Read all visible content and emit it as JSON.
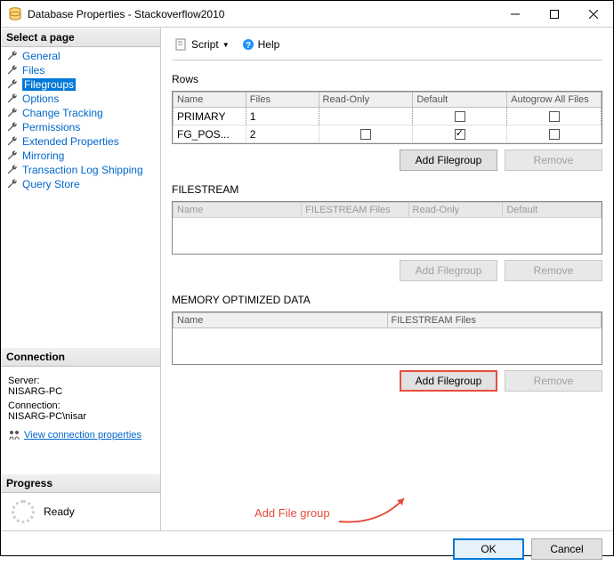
{
  "window": {
    "title": "Database Properties - Stackoverflow2010"
  },
  "sidebar": {
    "select_page": "Select a page",
    "items": [
      {
        "label": "General"
      },
      {
        "label": "Files"
      },
      {
        "label": "Filegroups"
      },
      {
        "label": "Options"
      },
      {
        "label": "Change Tracking"
      },
      {
        "label": "Permissions"
      },
      {
        "label": "Extended Properties"
      },
      {
        "label": "Mirroring"
      },
      {
        "label": "Transaction Log Shipping"
      },
      {
        "label": "Query Store"
      }
    ],
    "connection_header": "Connection",
    "server_label": "Server:",
    "server_value": "NISARG-PC",
    "connection_label": "Connection:",
    "connection_value": "NISARG-PC\\nisar",
    "view_conn_props": "View connection properties",
    "progress_header": "Progress",
    "progress_status": "Ready"
  },
  "toolbar": {
    "script": "Script",
    "help": "Help"
  },
  "rows": {
    "title": "Rows",
    "headers": [
      "Name",
      "Files",
      "Read-Only",
      "Default",
      "Autogrow All Files"
    ],
    "data": [
      {
        "name": "PRIMARY",
        "files": "1",
        "readonly": null,
        "default": false,
        "autogrow": false
      },
      {
        "name": "FG_POS...",
        "files": "2",
        "readonly": false,
        "default": true,
        "autogrow": false
      }
    ],
    "add": "Add Filegroup",
    "remove": "Remove"
  },
  "filestream": {
    "title": "FILESTREAM",
    "headers": [
      "Name",
      "FILESTREAM Files",
      "Read-Only",
      "Default"
    ],
    "add": "Add Filegroup",
    "remove": "Remove"
  },
  "memopt": {
    "title": "MEMORY OPTIMIZED DATA",
    "headers": [
      "Name",
      "FILESTREAM Files"
    ],
    "add": "Add Filegroup",
    "remove": "Remove"
  },
  "footer": {
    "ok": "OK",
    "cancel": "Cancel"
  },
  "annotation": "Add File group"
}
